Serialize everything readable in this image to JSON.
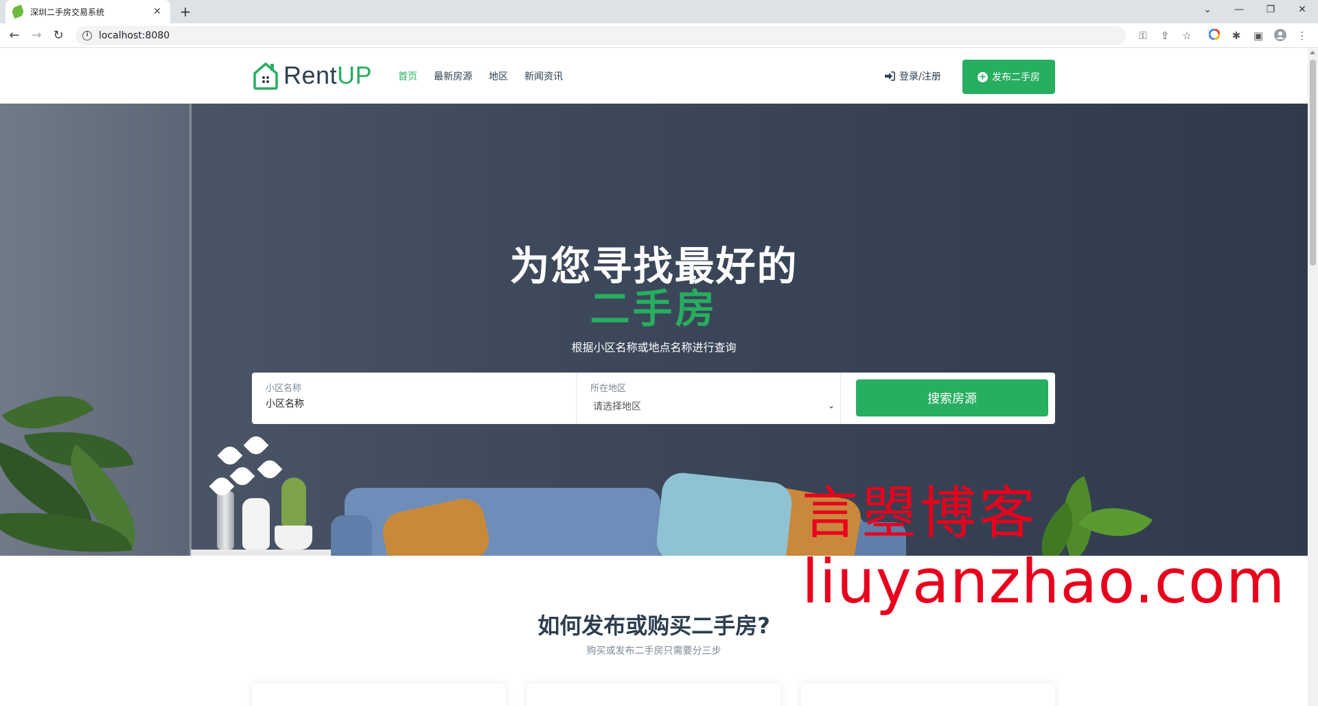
{
  "browser": {
    "tab_title": "深圳二手房交易系统",
    "tab_close": "✕",
    "new_tab": "+",
    "url": "localhost:8080",
    "window_controls": [
      "minimize-icon",
      "maximize-icon",
      "close-icon"
    ]
  },
  "header": {
    "logo_rent": "Rent",
    "logo_up": "UP",
    "nav": [
      {
        "label": "首页",
        "active": true
      },
      {
        "label": "最新房源",
        "active": false
      },
      {
        "label": "地区",
        "active": false
      },
      {
        "label": "新闻资讯",
        "active": false
      }
    ],
    "login_label": "登录/注册",
    "publish_label": "发布二手房"
  },
  "hero": {
    "title": "为您寻找最好的",
    "accent": "二手房",
    "subtitle": "根据小区名称或地点名称进行查询"
  },
  "search": {
    "community_label": "小区名称",
    "community_placeholder": "小区名称",
    "region_label": "所在地区",
    "region_selected": "请选择地区",
    "button_label": "搜索房源"
  },
  "section": {
    "title": "如何发布或购买二手房?",
    "subtitle": "购买或发布二手房只需要分三步"
  },
  "watermark": {
    "cn": "言曌博客",
    "en": "liuyanzhao.com"
  },
  "colors": {
    "accent": "#27ae60",
    "text_dark": "#2c3e50",
    "watermark": "#e8001c"
  }
}
